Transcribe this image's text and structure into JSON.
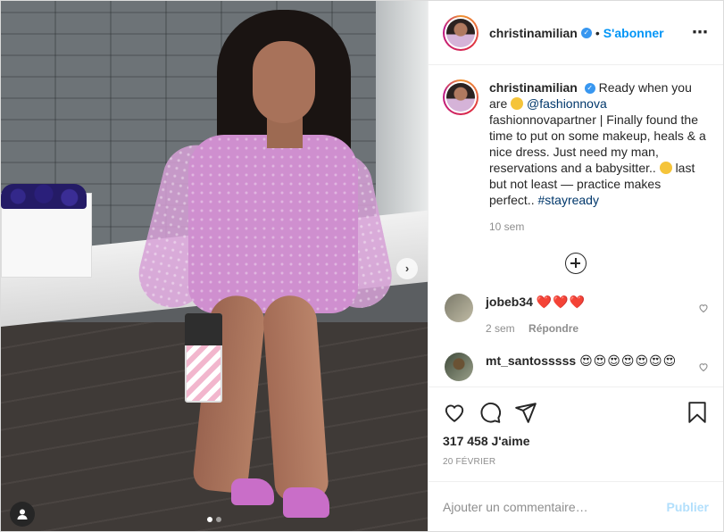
{
  "post": {
    "username": "christinamilian",
    "follow_label": "S'abonner",
    "separator": "•",
    "more_icon": "⋯"
  },
  "caption": {
    "username": "christinamilian",
    "text_1": "Ready when you are",
    "mention": "@fashionnova",
    "text_2": "fashionnovapartner | Finally found the time to put on some makeup, heals & a nice dress. Just need my man, reservations and a babysitter..",
    "text_3": "last but not least — practice makes perfect..",
    "hashtag": "#stayready",
    "time": "10 sem"
  },
  "comments": [
    {
      "username": "jobeb34",
      "text": "❤️❤️❤️",
      "time": "2 sem",
      "reply": "Répondre"
    },
    {
      "username": "mt_santosssss",
      "text": "😍😍😍😍😍😍😍"
    }
  ],
  "likes": "317 458 J'aime",
  "date": "20 FÉVRIER",
  "add_comment": {
    "placeholder": "Ajouter un commentaire…",
    "publish": "Publier"
  },
  "carousel": {
    "count": 2,
    "active": 1
  },
  "colors": {
    "accent": "#0095f6",
    "publish_disabled": "#b2dffc",
    "muted": "#8e8e8e"
  }
}
